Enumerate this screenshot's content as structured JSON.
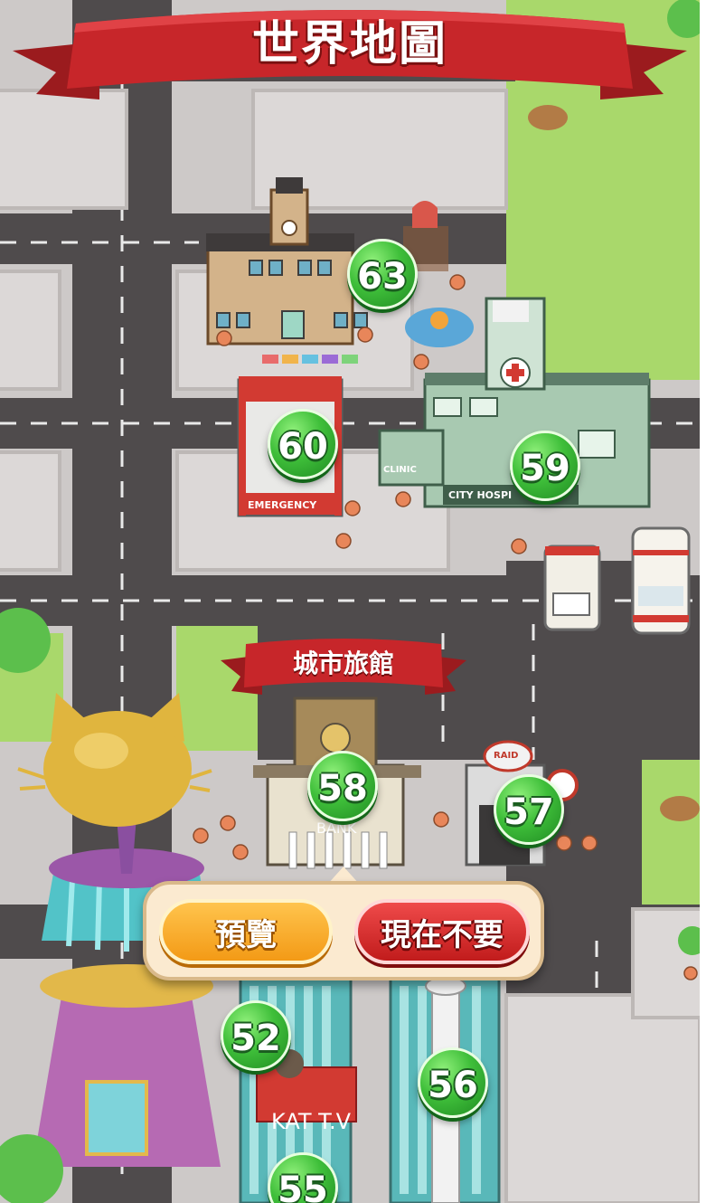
{
  "header": {
    "title": "世界地圖"
  },
  "map": {
    "selected_location_label": "城市旅館",
    "levels": [
      "63",
      "60",
      "59",
      "58",
      "57",
      "52",
      "56",
      "55"
    ],
    "signs": {
      "emergency": "EMERGENCY",
      "clinic": "CLINIC",
      "hospital": "CITY HOSPI",
      "bank": "BANK",
      "tv": "KAT T.V",
      "raid": "RAID"
    }
  },
  "popup": {
    "preview_label": "預覽",
    "not_now_label": "現在不要"
  },
  "colors": {
    "ribbon": "#c7262a",
    "badge_green": "#3fbf3a",
    "preview_orange": "#f39a16",
    "not_now_red": "#c11c1c",
    "road": "#4f4b4c",
    "grass": "#a8d86a"
  }
}
